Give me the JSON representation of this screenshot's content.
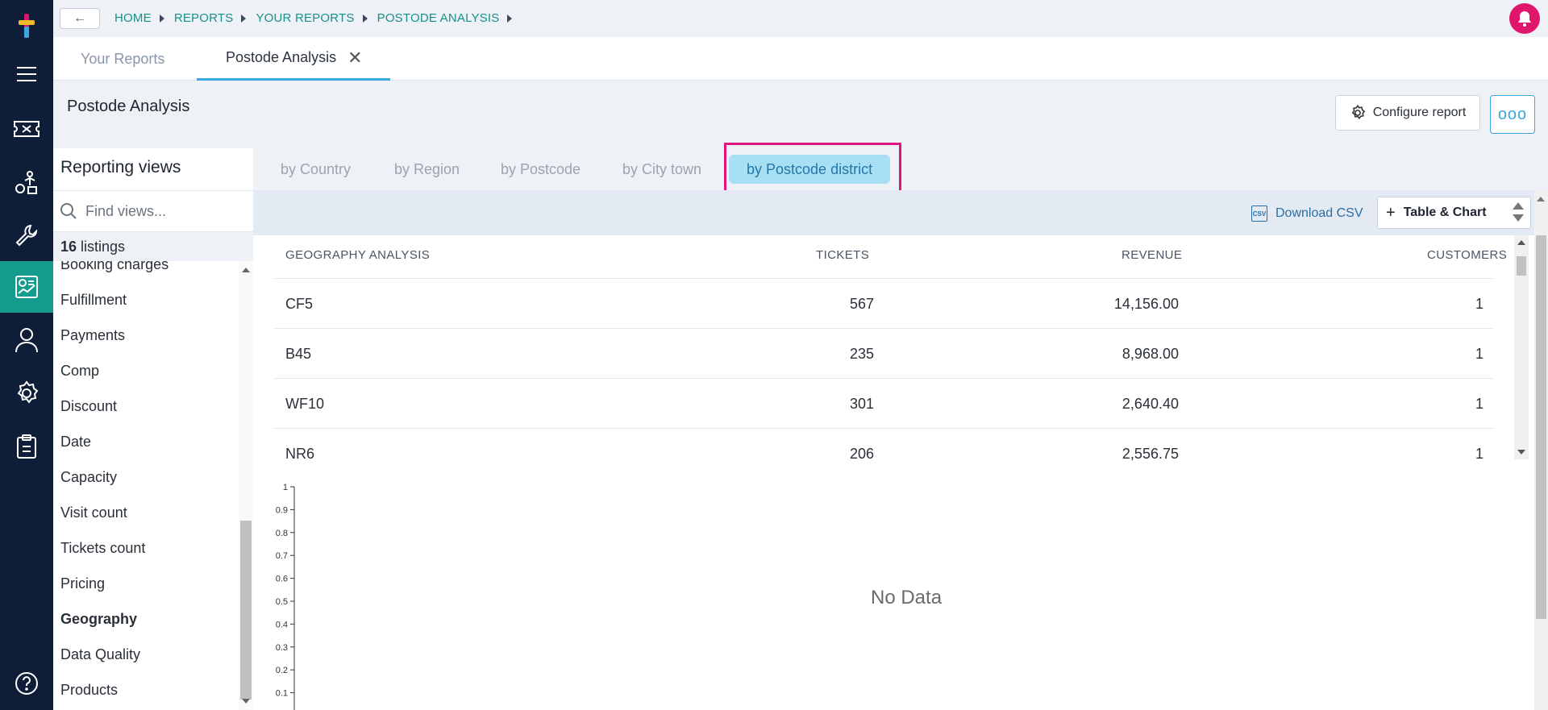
{
  "topbar": {
    "back_symbol": "←",
    "breadcrumb": [
      "HOME",
      "REPORTS",
      "YOUR REPORTS",
      "POSTODE ANALYSIS"
    ]
  },
  "tabs": [
    {
      "label": "Your Reports",
      "active": false
    },
    {
      "label": "Postode Analysis",
      "active": true,
      "close": "✕"
    }
  ],
  "page": {
    "title": "Postode Analysis",
    "configure_label": "Configure report",
    "more_label": "ooo"
  },
  "views": {
    "title": "Reporting views",
    "search_placeholder": "Find views...",
    "listings_count": "16",
    "listings_label": " listings",
    "items": [
      {
        "label": "Booking charges",
        "bold": false
      },
      {
        "label": "Fulfillment",
        "bold": false
      },
      {
        "label": "Payments",
        "bold": false
      },
      {
        "label": "Comp",
        "bold": false
      },
      {
        "label": "Discount",
        "bold": false
      },
      {
        "label": "Date",
        "bold": false
      },
      {
        "label": "Capacity",
        "bold": false
      },
      {
        "label": "Visit count",
        "bold": false
      },
      {
        "label": "Tickets count",
        "bold": false
      },
      {
        "label": "Pricing",
        "bold": false
      },
      {
        "label": "Geography",
        "bold": true
      },
      {
        "label": "Data Quality",
        "bold": false
      },
      {
        "label": "Products",
        "bold": false
      }
    ]
  },
  "subtabs": [
    {
      "label": "by Country",
      "active": false
    },
    {
      "label": "by Region",
      "active": false
    },
    {
      "label": "by Postcode",
      "active": false
    },
    {
      "label": "by City town",
      "active": false
    },
    {
      "label": "by Postcode district",
      "active": true
    }
  ],
  "toolbar": {
    "csv_icon_text": "CSV",
    "download_label": "Download CSV",
    "view_plus": "+",
    "view_label": "Table & Chart"
  },
  "table": {
    "headers": [
      "GEOGRAPHY ANALYSIS",
      "TICKETS",
      "REVENUE",
      "CUSTOMERS"
    ],
    "rows": [
      [
        "CF5",
        "567",
        "14,156.00",
        "1"
      ],
      [
        "B45",
        "235",
        "8,968.00",
        "1"
      ],
      [
        "WF10",
        "301",
        "2,640.40",
        "1"
      ],
      [
        "NR6",
        "206",
        "2,556.75",
        "1"
      ]
    ]
  },
  "chart_data": {
    "type": "line",
    "ylim": [
      0,
      1
    ],
    "yticks": [
      "1",
      "0.9",
      "0.8",
      "0.7",
      "0.6",
      "0.5",
      "0.4",
      "0.3",
      "0.2",
      "0.1"
    ],
    "series": [],
    "message": "No Data"
  },
  "colors": {
    "rail": "#0e1d38",
    "rail_active": "#139b8e",
    "breadcrumb": "#15918a",
    "bell": "#e0156c",
    "accent": "#3aa7e0",
    "subtab_active_bg": "#a9dff5",
    "highlight": "#e0157d"
  }
}
